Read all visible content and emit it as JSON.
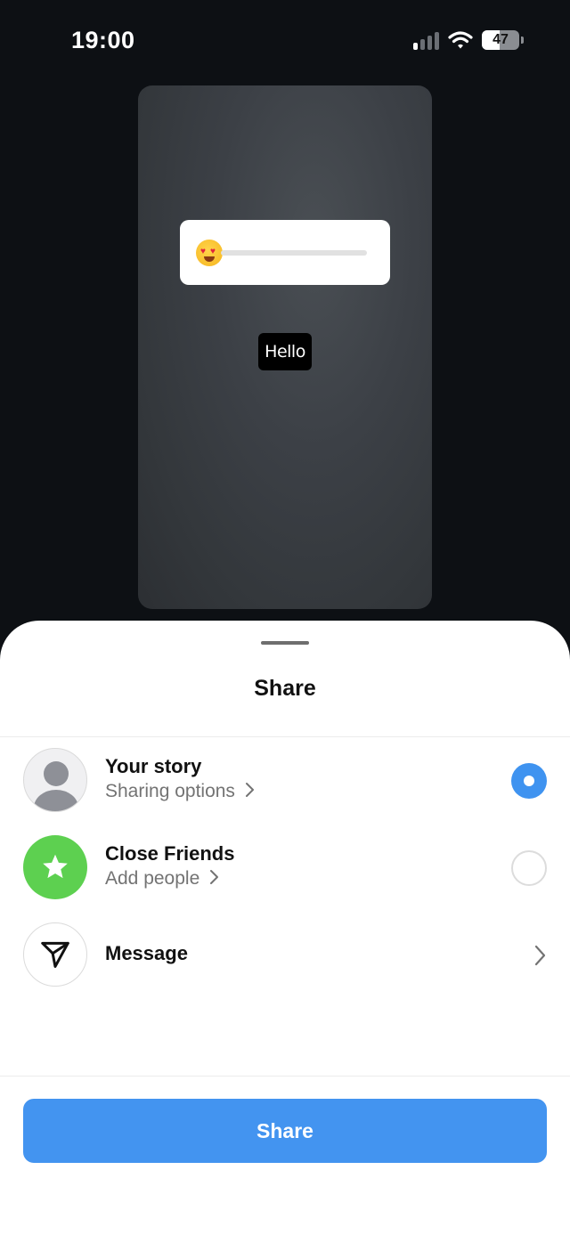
{
  "status_bar": {
    "time": "19:00",
    "battery_level": "47",
    "battery_fraction": 0.47,
    "signal_bars_active": 1
  },
  "story_preview": {
    "emoji_slider_emoji": "heart-eyes-emoji",
    "text_sticker": "Hello"
  },
  "sheet": {
    "title": "Share",
    "options": [
      {
        "title": "Your story",
        "subtitle": "Sharing options",
        "icon": "profile-avatar-icon",
        "selected": true
      },
      {
        "title": "Close Friends",
        "subtitle": "Add people",
        "icon": "star-icon",
        "selected": false
      },
      {
        "title": "Message",
        "icon": "paper-plane-icon"
      }
    ],
    "share_button_label": "Share"
  },
  "colors": {
    "accent": "#4394f0",
    "close_friends_green": "#5dd050",
    "background_dark": "#0d1014"
  }
}
